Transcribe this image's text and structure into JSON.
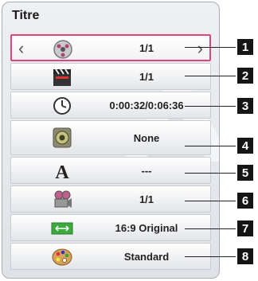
{
  "panel": {
    "title": "Titre"
  },
  "rows": [
    {
      "icon": "disc-icon",
      "value": "1/1"
    },
    {
      "icon": "clapperboard-icon",
      "value": "1/1"
    },
    {
      "icon": "clock-icon",
      "value": "0:00:32/0:06:36"
    },
    {
      "icon": "speaker-icon",
      "value": "None"
    },
    {
      "icon": "subtitle-a-icon",
      "value": "---"
    },
    {
      "icon": "camera-angle-icon",
      "value": "1/1"
    },
    {
      "icon": "aspect-ratio-icon",
      "value": "16:9 Original"
    },
    {
      "icon": "picture-mode-icon",
      "value": "Standard"
    }
  ],
  "callouts": [
    "1",
    "2",
    "3",
    "4",
    "5",
    "6",
    "7",
    "8"
  ],
  "nav": {
    "prev": "‹",
    "next": "›"
  },
  "colors": {
    "selection_border": "#e0457a"
  }
}
